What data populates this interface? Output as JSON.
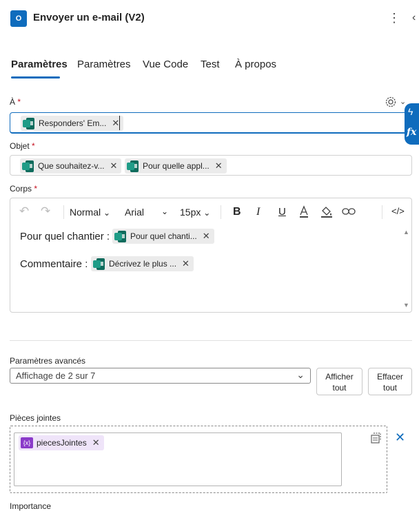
{
  "header": {
    "app_badge": "O",
    "title": "Envoyer un e-mail (V2)",
    "more_glyph": "⋮",
    "collapse_glyph": "‹"
  },
  "tabs": [
    {
      "label": "Paramètres",
      "active": true
    },
    {
      "label": "Paramètres",
      "active": false
    },
    {
      "label": "Vue Code",
      "active": false
    },
    {
      "label": "Test",
      "active": false
    },
    {
      "label": "À propos",
      "active": false
    }
  ],
  "fields": {
    "to": {
      "label": "À",
      "required_mark": "*",
      "tokens": [
        {
          "text": "Responders' Em...",
          "icon": "forms-icon"
        }
      ]
    },
    "subject": {
      "label": "Objet",
      "required_mark": "*",
      "tokens": [
        {
          "text": "Que souhaitez-v...",
          "icon": "forms-icon"
        },
        {
          "text": "Pour quelle appl...",
          "icon": "forms-icon"
        }
      ]
    },
    "body": {
      "label": "Corps",
      "required_mark": "*",
      "toolbar": {
        "format": "Normal",
        "font": "Arial",
        "size": "15px",
        "bold": "B",
        "italic": "I",
        "underline": "U"
      },
      "lines": [
        {
          "text": "Pour quel chantier :",
          "token": "Pour quel chanti..."
        },
        {
          "text": "Commentaire :",
          "token": "Décrivez le plus ..."
        }
      ]
    }
  },
  "side_pill": {
    "dynamic_glyph": "ϟ",
    "fx_label": "fx"
  },
  "advanced": {
    "label": "Paramètres avancés",
    "select_value": "Affichage de 2 sur 7",
    "show_all": [
      "Afficher",
      "tout"
    ],
    "clear_all": [
      "Effacer",
      "tout"
    ]
  },
  "attachments": {
    "label": "Pièces jointes",
    "token": {
      "text": "piecesJointes",
      "badge": "{x}"
    }
  },
  "importance": {
    "label": "Importance"
  },
  "colors": {
    "accent": "#0F6CBD",
    "required": "#C50F1F",
    "variable_token": "#EFE4F9",
    "variable_badge": "#8A3AC9",
    "forms_icon": "#0E6B5C"
  }
}
